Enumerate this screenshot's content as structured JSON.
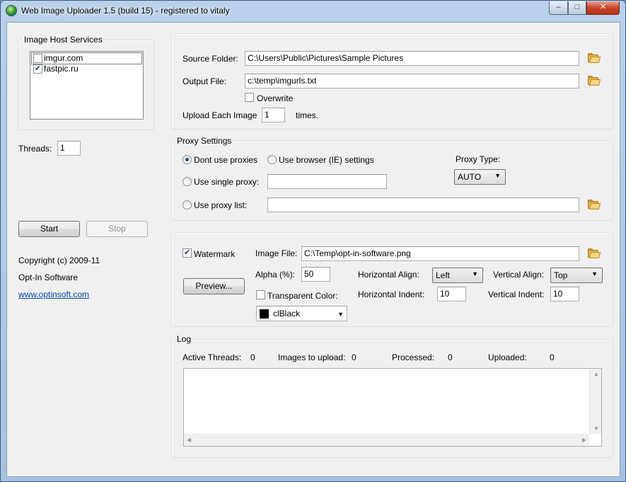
{
  "window": {
    "title": "Web Image Uploader 1.5 (build 15) - registered to vitaly",
    "min_glyph": "–",
    "max_glyph": "□",
    "close_glyph": "✕"
  },
  "hosts": {
    "title": "Image Host Services",
    "items": [
      {
        "label": "imgur.com",
        "checked": false
      },
      {
        "label": "fastpic.ru",
        "checked": true
      }
    ]
  },
  "threads": {
    "label": "Threads:",
    "value": "1"
  },
  "controls": {
    "start": "Start",
    "stop": "Stop"
  },
  "about": {
    "copyright": "Copyright (c) 2009-11",
    "company": "Opt-In Software",
    "website": "www.optinsoft.com"
  },
  "source": {
    "source_label": "Source Folder:",
    "source_value": "C:\\Users\\Public\\Pictures\\Sample Pictures",
    "output_label": "Output File:",
    "output_value": "c:\\temp\\imgurls.txt",
    "overwrite_label": "Overwrite",
    "upload_each_label": "Upload Each Image",
    "upload_each_value": "1",
    "times_label": "times."
  },
  "proxy": {
    "title": "Proxy Settings",
    "no_proxy": "Dont use proxies",
    "browser": "Use browser (IE) settings",
    "single": "Use single proxy:",
    "single_value": "",
    "list": "Use proxy list:",
    "list_value": "",
    "type_label": "Proxy Type:",
    "type_value": "AUTO"
  },
  "watermark": {
    "checkbox_label": "Watermark",
    "image_file_label": "Image File:",
    "image_file_value": "C:\\Temp\\opt-in-software.png",
    "alpha_label": "Alpha (%):",
    "alpha_value": "50",
    "h_align_label": "Horizontal Align:",
    "h_align_value": "Left",
    "v_align_label": "Vertical Align:",
    "v_align_value": "Top",
    "preview": "Preview...",
    "transparent_label": "Transparent Color:",
    "h_indent_label": "Horizontal Indent:",
    "h_indent_value": "10",
    "v_indent_label": "Vertical Indent:",
    "v_indent_value": "10",
    "color_value": "clBlack"
  },
  "log": {
    "title": "Log",
    "active_threads_label": "Active Threads:",
    "active_threads_value": "0",
    "images_label": "Images to upload:",
    "images_value": "0",
    "processed_label": "Processed:",
    "processed_value": "0",
    "uploaded_label": "Uploaded:",
    "uploaded_value": "0",
    "content": ""
  }
}
